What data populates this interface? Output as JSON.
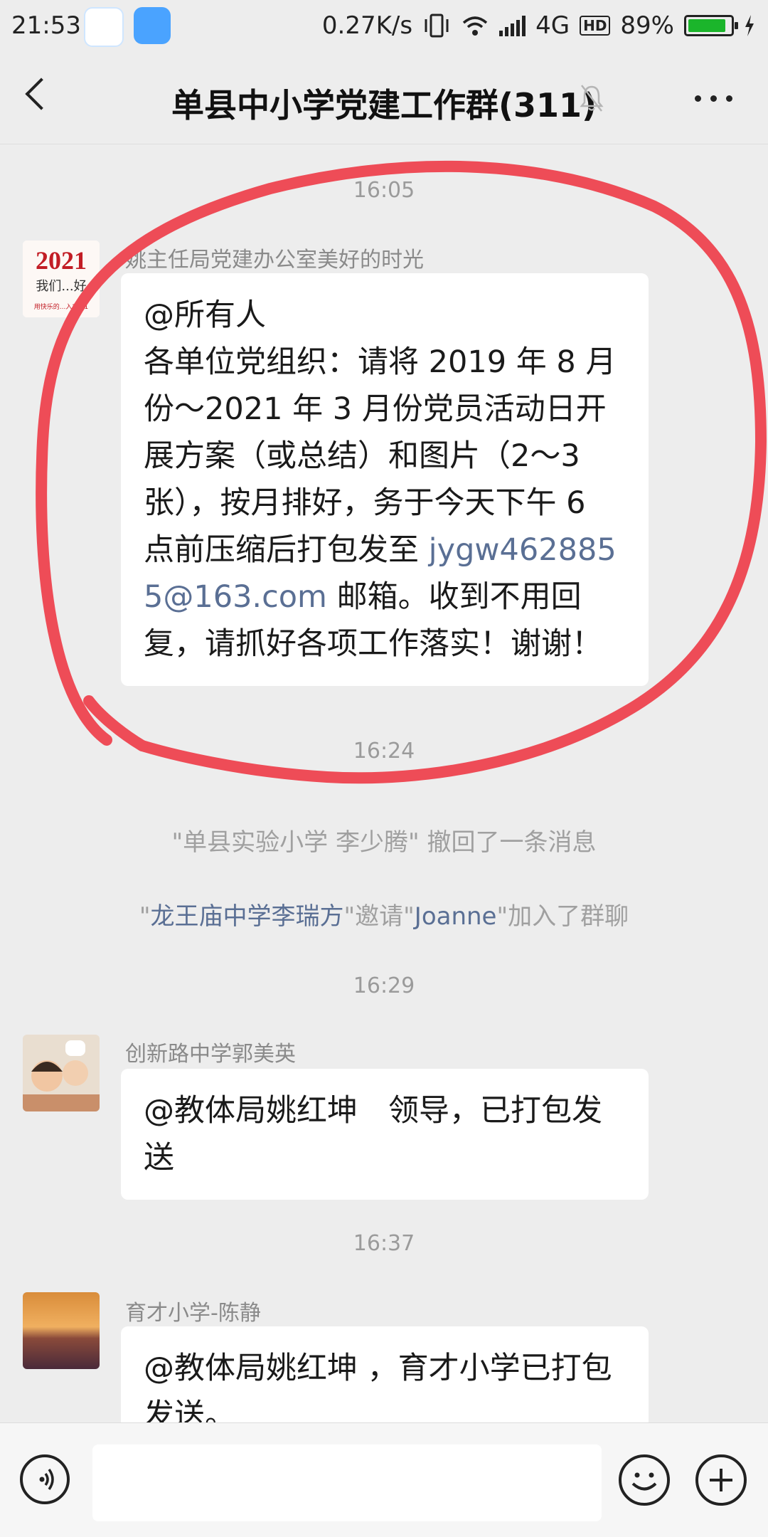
{
  "status_bar": {
    "time": "21:53",
    "speed": "0.27K/s",
    "network": "4G",
    "hd": "HD",
    "battery_percent": "89%",
    "battery_level": 0.89
  },
  "nav": {
    "title": "单县中小学党建工作群(311)"
  },
  "messages": {
    "ts1": "16:05",
    "m1": {
      "sender": "姚主任局党建办公室美好的时光",
      "avatar_text": "2021",
      "avatar_caption": "我们...好",
      "avatar_sub": "用快乐的...入2021",
      "line1": "@所有人",
      "text_before_email": "各单位党组织：请将 2019 年 8 月份～2021 年 3 月份党员活动日开展方案（或总结）和图片（2～3张），按月排好，务于今天下午 6 点前压缩后打包发至 ",
      "email": "jygw4628855@163.com",
      "text_after_email": " 邮箱。收到不用回复，请抓好各项工作落实！谢谢！"
    },
    "ts2": "16:24",
    "recall": "\"单县实验小学 李少腾\" 撤回了一条消息",
    "invite": {
      "q1": "\"",
      "inviter": "龙王庙中学李瑞方",
      "mid": "\"邀请\"",
      "invitee": "Joanne",
      "tail": "\"加入了群聊"
    },
    "ts3": "16:29",
    "m2": {
      "sender": "创新路中学郭美英",
      "text": "@教体局姚红坤　领导，已打包发送"
    },
    "ts4": "16:37",
    "m3": {
      "sender": "育才小学-陈静",
      "text": "@教体局姚红坤 ，育才小学已打包发送。"
    }
  },
  "colors": {
    "background": "#EDEDED",
    "link": "#5a6f94",
    "annotation": "#EE4C57"
  },
  "icons": {
    "back": "back-arrow-icon",
    "mute": "mute-bell-icon",
    "more": "more-icon",
    "voice": "voice-icon",
    "emoji": "emoji-icon",
    "plus": "plus-icon"
  }
}
